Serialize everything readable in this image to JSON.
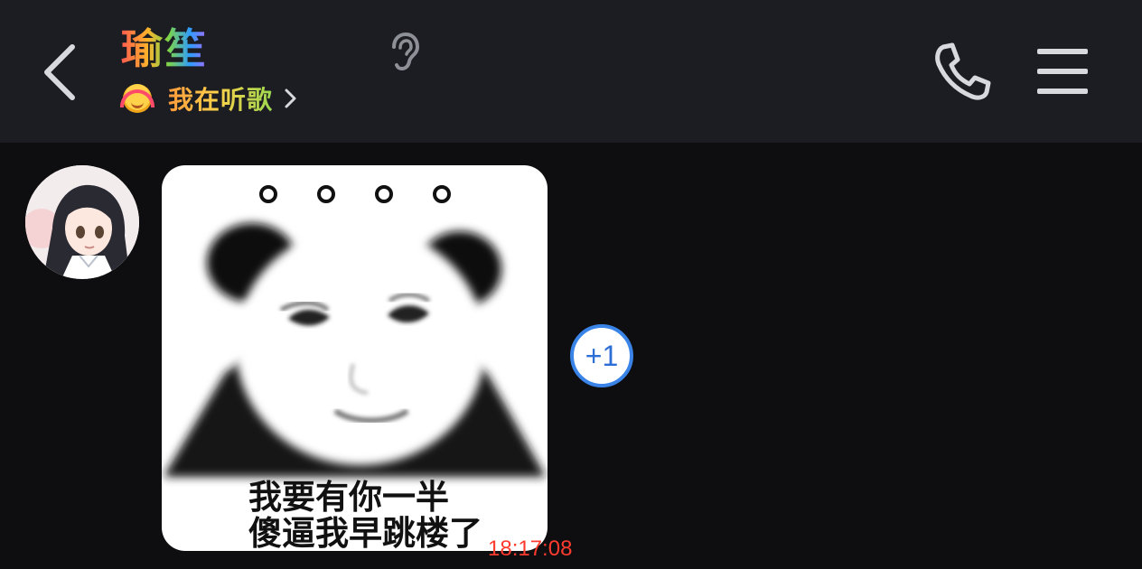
{
  "header": {
    "contact_name": "瑜笙",
    "status_text": "我在听歌",
    "icons": [
      "chevron-left-icon",
      "ear-icon",
      "phone-icon",
      "hamburger-menu-icon",
      "headphones-emoji-icon",
      "chevron-right-icon"
    ]
  },
  "message": {
    "meme_dots": "。。。。",
    "meme_caption": "我要有你一半\n傻逼我早跳楼了",
    "plus_one": "+1",
    "time": "18:17:08"
  },
  "colors": {
    "header_bg": "#1b1d22",
    "chat_bg": "#0e0e10",
    "timestamp": "#ff3b2f",
    "plus_one_accent": "#3a84e8"
  }
}
